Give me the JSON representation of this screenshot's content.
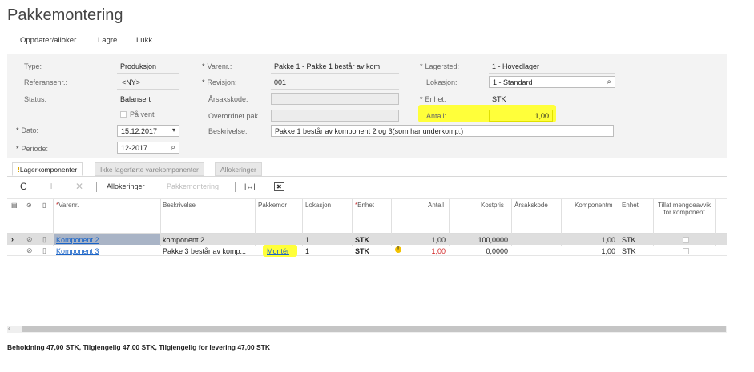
{
  "page": {
    "title": "Pakkemontering"
  },
  "toolbar": {
    "update": "Oppdater/alloker",
    "save": "Lagre",
    "close": "Lukk"
  },
  "form": {
    "type_label": "Type:",
    "type_value": "Produksjon",
    "ref_label": "Referansenr.:",
    "ref_value": "<NY>",
    "status_label": "Status:",
    "status_value": "Balansert",
    "hold_label": "På vent",
    "date_label": "Dato:",
    "date_value": "15.12.2017",
    "period_label": "Periode:",
    "period_value": "12-2017",
    "item_label": "Varenr.:",
    "item_value": "Pakke 1 - Pakke 1 består av kom",
    "rev_label": "Revisjon:",
    "rev_value": "001",
    "reason_label": "Årsakskode:",
    "reason_value": "",
    "parent_label": "Overordnet pak...",
    "desc_label": "Beskrivelse:",
    "desc_value": "Pakke 1 består av komponent 2 og 3(som har underkomp.)",
    "warehouse_label": "Lagersted:",
    "warehouse_value": "1 - Hovedlager",
    "location_label": "Lokasjon:",
    "location_value": "1 - Standard",
    "unit_label": "Enhet:",
    "unit_value": "STK",
    "qty_label": "Antall:",
    "qty_value": "1,00",
    "req_mark": "*"
  },
  "tabs": [
    {
      "label": "Lagerkomponenter",
      "warn": "!"
    },
    {
      "label": "Ikke lagerførte varekomponenter"
    },
    {
      "label": "Allokeringer"
    }
  ],
  "grid_toolbar": {
    "refresh": "C",
    "add": "+",
    "delete": "✕",
    "allocations": "Allokeringer",
    "assembly": "Pakkemontering",
    "fit": "|↔|",
    "excel": "✖"
  },
  "grid": {
    "columns": {
      "item": "Varenr.",
      "desc": "Beskrivelse",
      "parent": "Pakkemor",
      "location": "Lokasjon",
      "unit": "Enhet",
      "qty": "Antall",
      "cost": "Kostpris",
      "reason": "Årsakskode",
      "compqty": "Komponentm",
      "unit2": "Enhet",
      "allow": "Tillat mengdeavvik for komponent"
    },
    "rows": [
      {
        "item": "Komponent 2",
        "desc": "komponent 2",
        "parent": "",
        "location": "1",
        "unit": "STK",
        "warn": "",
        "qty": "1,00",
        "cost": "100,0000",
        "reason": "",
        "compqty": "1,00",
        "unit2": "STK"
      },
      {
        "item": "Komponent 3",
        "desc": "Pakke 3 består av komp...",
        "parent": "Montér",
        "location": "1",
        "unit": "STK",
        "warn": "!",
        "qty": "1,00",
        "cost": "0,0000",
        "reason": "",
        "compqty": "1,00",
        "unit2": "STK"
      }
    ]
  },
  "status_bar": {
    "text": "Beholdning 47,00 STK, Tilgjengelig 47,00 STK, Tilgjengelig for levering 47,00 STK"
  },
  "colors": {
    "highlight": "#ffff3a",
    "link": "#1a64c8",
    "warn": "#f2c200",
    "qty_red": "#d02020"
  }
}
